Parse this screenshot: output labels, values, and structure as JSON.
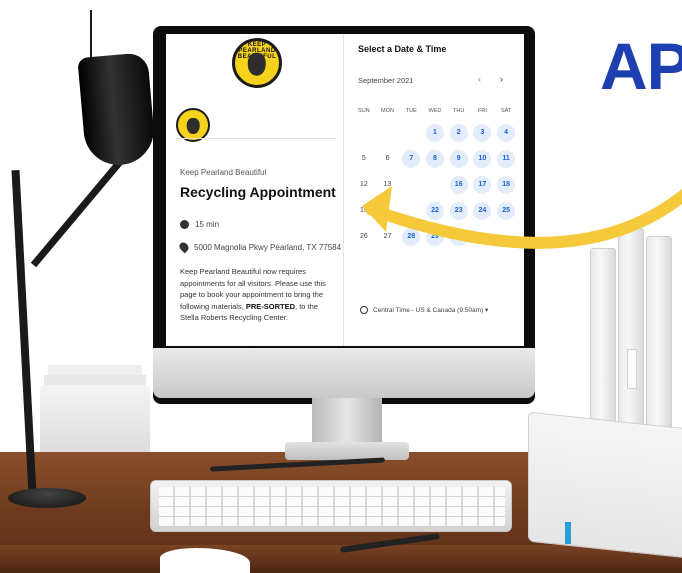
{
  "headline": "AP",
  "booking": {
    "logo_text": "KEEP PEARLAND BEAUTIFUL",
    "organization": "Keep Pearland Beautiful",
    "event_title": "Recycling Appointment",
    "duration": "15 min",
    "location": "5000 Magnolia Pkwy Pearland, TX 77584",
    "description_part1": "Keep Pearland Beautiful now requires appointments for all visitors. Please use this page to book your appointment to bring the following materials, ",
    "description_bold": "PRE-SORTED",
    "description_part2": ", to the Stella Roberts Recycling Center."
  },
  "calendar": {
    "heading": "Select a Date & Time",
    "month": "September 2021",
    "prev_icon": "‹",
    "next_icon": "›",
    "weekdays": [
      "SUN",
      "MON",
      "TUE",
      "WED",
      "THU",
      "FRI",
      "SAT"
    ],
    "days": [
      {
        "label": "",
        "available": false
      },
      {
        "label": "",
        "available": false
      },
      {
        "label": "",
        "available": false
      },
      {
        "label": "1",
        "available": true
      },
      {
        "label": "2",
        "available": true
      },
      {
        "label": "3",
        "available": true
      },
      {
        "label": "4",
        "available": true
      },
      {
        "label": "5",
        "available": false
      },
      {
        "label": "6",
        "available": false
      },
      {
        "label": "7",
        "available": true
      },
      {
        "label": "8",
        "available": true
      },
      {
        "label": "9",
        "available": true
      },
      {
        "label": "10",
        "available": true
      },
      {
        "label": "11",
        "available": true
      },
      {
        "label": "12",
        "available": false
      },
      {
        "label": "13",
        "available": false
      },
      {
        "label": "",
        "available": false
      },
      {
        "label": "",
        "available": false
      },
      {
        "label": "16",
        "available": true
      },
      {
        "label": "17",
        "available": true
      },
      {
        "label": "18",
        "available": true
      },
      {
        "label": "19",
        "available": false
      },
      {
        "label": "",
        "available": false
      },
      {
        "label": "",
        "available": false
      },
      {
        "label": "22",
        "available": true
      },
      {
        "label": "23",
        "available": true
      },
      {
        "label": "24",
        "available": true
      },
      {
        "label": "25",
        "available": true
      },
      {
        "label": "26",
        "available": false
      },
      {
        "label": "27",
        "available": false
      },
      {
        "label": "28",
        "available": true
      },
      {
        "label": "29",
        "available": true
      },
      {
        "label": "30",
        "available": true
      },
      {
        "label": "",
        "available": false
      },
      {
        "label": "",
        "available": false
      }
    ],
    "timezone": "Central Time - US & Canada (9:50am) ▾"
  },
  "colors": {
    "headline": "#1d3fb0",
    "arrow": "#f6c93a",
    "available_bg": "#e3ecfb",
    "available_text": "#1a63d8"
  }
}
